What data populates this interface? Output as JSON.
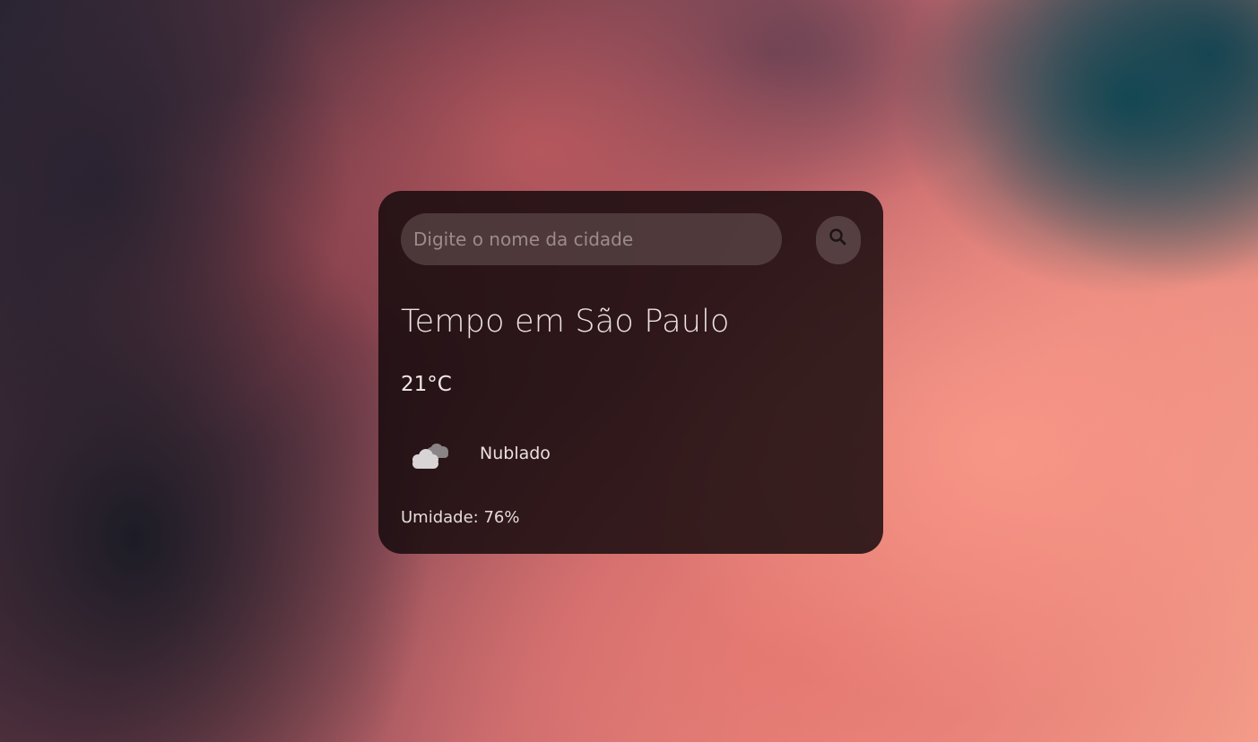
{
  "search": {
    "placeholder": "Digite o nome da cidade",
    "value": ""
  },
  "search_button": {
    "icon": "search-icon"
  },
  "weather": {
    "title": "Tempo em São Paulo",
    "temperature": "21°C",
    "condition": "Nublado",
    "condition_icon": "cloud-icon",
    "humidity": "Umidade: 76%"
  },
  "colors": {
    "card_background": "#140a0c",
    "text": "#ece2e2",
    "input_background": "#786464"
  }
}
